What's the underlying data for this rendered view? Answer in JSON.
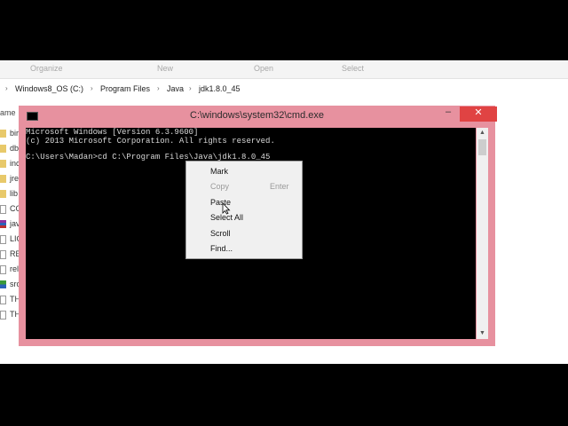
{
  "ribbon": {
    "organize": "Organize",
    "new": "New",
    "open": "Open",
    "select": "Select"
  },
  "breadcrumb": [
    "Windows8_OS (C:)",
    "Program Files",
    "Java",
    "jdk1.8.0_45"
  ],
  "left_pane": {
    "header": "ame",
    "items": [
      {
        "label": "bir",
        "icon": "folder-icon"
      },
      {
        "label": "db",
        "icon": "folder-icon"
      },
      {
        "label": "inc",
        "icon": "folder-icon"
      },
      {
        "label": "jre",
        "icon": "folder-icon"
      },
      {
        "label": "lib",
        "icon": "folder-icon"
      },
      {
        "label": "CO",
        "icon": "file-icon"
      },
      {
        "label": "jav",
        "icon": "archive-icon"
      },
      {
        "label": "LIC",
        "icon": "file-icon"
      },
      {
        "label": "RE",
        "icon": "file-icon"
      },
      {
        "label": "rel",
        "icon": "file-icon"
      },
      {
        "label": "src",
        "icon": "zip-icon"
      },
      {
        "label": "TH",
        "icon": "file-icon"
      },
      {
        "label": "TH",
        "icon": "file-icon"
      }
    ]
  },
  "cmd": {
    "title": "C:\\windows\\system32\\cmd.exe",
    "minimize": "–",
    "maximize": "□",
    "close": "✕",
    "lines": [
      "Microsoft Windows [Version 6.3.9600]",
      "(c) 2013 Microsoft Corporation. All rights reserved.",
      "",
      "C:\\Users\\Madan>cd C:\\Program Files\\Java\\jdk1.8.0_45"
    ],
    "scroll_up": "▲",
    "scroll_down": "▼"
  },
  "context_menu": {
    "items": [
      {
        "label": "Mark",
        "accel": "",
        "enabled": true
      },
      {
        "label": "Copy",
        "accel": "Enter",
        "enabled": false
      },
      {
        "label": "Paste",
        "accel": "",
        "enabled": true
      },
      {
        "label": "Select All",
        "accel": "",
        "enabled": true
      },
      {
        "label": "Scroll",
        "accel": "",
        "enabled": true
      },
      {
        "label": "Find...",
        "accel": "",
        "enabled": true
      }
    ]
  },
  "colors": {
    "cmd_frame": "#e7919f",
    "close_button": "#e04343",
    "console_bg": "#000000"
  }
}
